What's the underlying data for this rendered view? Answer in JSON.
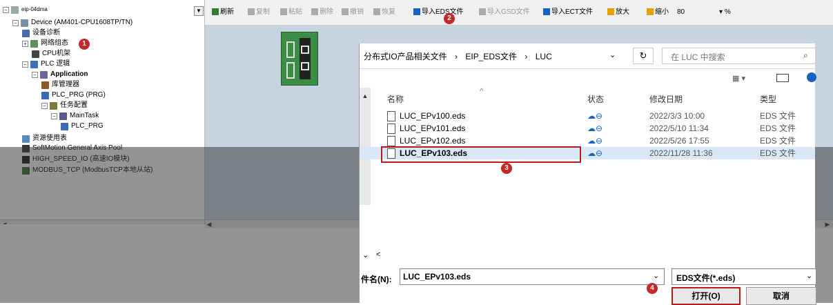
{
  "tree": {
    "project": "eip-04dma",
    "items": [
      {
        "label": "Device (AM401-CPU1608TP/TN)",
        "icon": "plc-icon",
        "level": 0,
        "expander": "−",
        "bold": false
      },
      {
        "label": "设备诊断",
        "icon": "diagnostic-icon",
        "level": 1,
        "expander": "",
        "bold": false
      },
      {
        "label": "网络组态",
        "icon": "network-icon",
        "level": 1,
        "expander": "+",
        "bold": false
      },
      {
        "label": "CPU机架",
        "icon": "rack-icon",
        "level": 2,
        "expander": "",
        "bold": false
      },
      {
        "label": "PLC 逻辑",
        "icon": "plc-logic-icon",
        "level": 1,
        "expander": "−",
        "bold": false
      },
      {
        "label": "Application",
        "icon": "application-icon",
        "level": 2,
        "expander": "−",
        "bold": true
      },
      {
        "label": "库管理器",
        "icon": "library-icon",
        "level": 3,
        "expander": "",
        "bold": false
      },
      {
        "label": "PLC_PRG (PRG)",
        "icon": "program-icon",
        "level": 3,
        "expander": "",
        "bold": false
      },
      {
        "label": "任务配置",
        "icon": "task-config-icon",
        "level": 3,
        "expander": "−",
        "bold": false
      },
      {
        "label": "MainTask",
        "icon": "task-icon",
        "level": 4,
        "expander": "−",
        "bold": false
      },
      {
        "label": "PLC_PRG",
        "icon": "program-icon",
        "level": 5,
        "expander": "",
        "bold": false
      },
      {
        "label": "资源使用表",
        "icon": "resource-icon",
        "level": 1,
        "expander": "",
        "bold": false
      },
      {
        "label": "SoftMotion General Axis Pool",
        "icon": "axis-icon",
        "level": 1,
        "expander": "",
        "bold": false
      },
      {
        "label": "HIGH_SPEED_IO (高速IO模块)",
        "icon": "hsio-icon",
        "level": 1,
        "expander": "",
        "bold": false
      },
      {
        "label": "MODBUS_TCP (ModbusTCP本地从站)",
        "icon": "modbus-icon",
        "level": 1,
        "expander": "",
        "bold": false
      }
    ]
  },
  "toolbar": {
    "buttons": [
      {
        "label": "刷新",
        "icon": "refresh-icon",
        "enabled": true
      },
      {
        "label": "复制",
        "icon": "copy-icon",
        "enabled": false
      },
      {
        "label": "粘贴",
        "icon": "paste-icon",
        "enabled": false
      },
      {
        "label": "删除",
        "icon": "delete-icon",
        "enabled": false
      },
      {
        "label": "撤销",
        "icon": "undo-icon",
        "enabled": false
      },
      {
        "label": "恢复",
        "icon": "redo-icon",
        "enabled": false
      },
      {
        "label": "导入EDS文件",
        "icon": "import-eds-icon",
        "enabled": true
      },
      {
        "label": "导入GSD文件",
        "icon": "import-gsd-icon",
        "enabled": false
      },
      {
        "label": "导入ECT文件",
        "icon": "import-ect-icon",
        "enabled": true
      },
      {
        "label": "放大",
        "icon": "zoom-in-icon",
        "enabled": true
      },
      {
        "label": "缩小",
        "icon": "zoom-out-icon",
        "enabled": true
      }
    ],
    "zoom": "80",
    "zoom_unit": "%"
  },
  "dialog": {
    "breadcrumb": [
      "分布式IO产品相关文件",
      "EIP_EDS文件",
      "LUC"
    ],
    "search_placeholder": "在 LUC 中搜索",
    "columns": [
      "名称",
      "状态",
      "修改日期",
      "类型"
    ],
    "files": [
      {
        "name": "LUC_EPv100.eds",
        "date": "2022/3/3 10:00",
        "type": "EDS 文件",
        "selected": false
      },
      {
        "name": "LUC_EPv101.eds",
        "date": "2022/5/10 11:34",
        "type": "EDS 文件",
        "selected": false
      },
      {
        "name": "LUC_EPv102.eds",
        "date": "2022/5/26 17:55",
        "type": "EDS 文件",
        "selected": false
      },
      {
        "name": "LUC_EPv103.eds",
        "date": "2022/11/28 11:36",
        "type": "EDS 文件",
        "selected": true
      }
    ],
    "filename_label": "件名(N):",
    "filename_value": "LUC_EPv103.eds",
    "filter_value": "EDS文件(*.eds)",
    "open_label": "打开(O)",
    "cancel_label": "取消"
  },
  "markers": [
    "1",
    "2",
    "3",
    "4"
  ],
  "colors": {
    "marker": "#c62828",
    "canvas": "#c8d3e0",
    "device": "#3b8d45"
  }
}
